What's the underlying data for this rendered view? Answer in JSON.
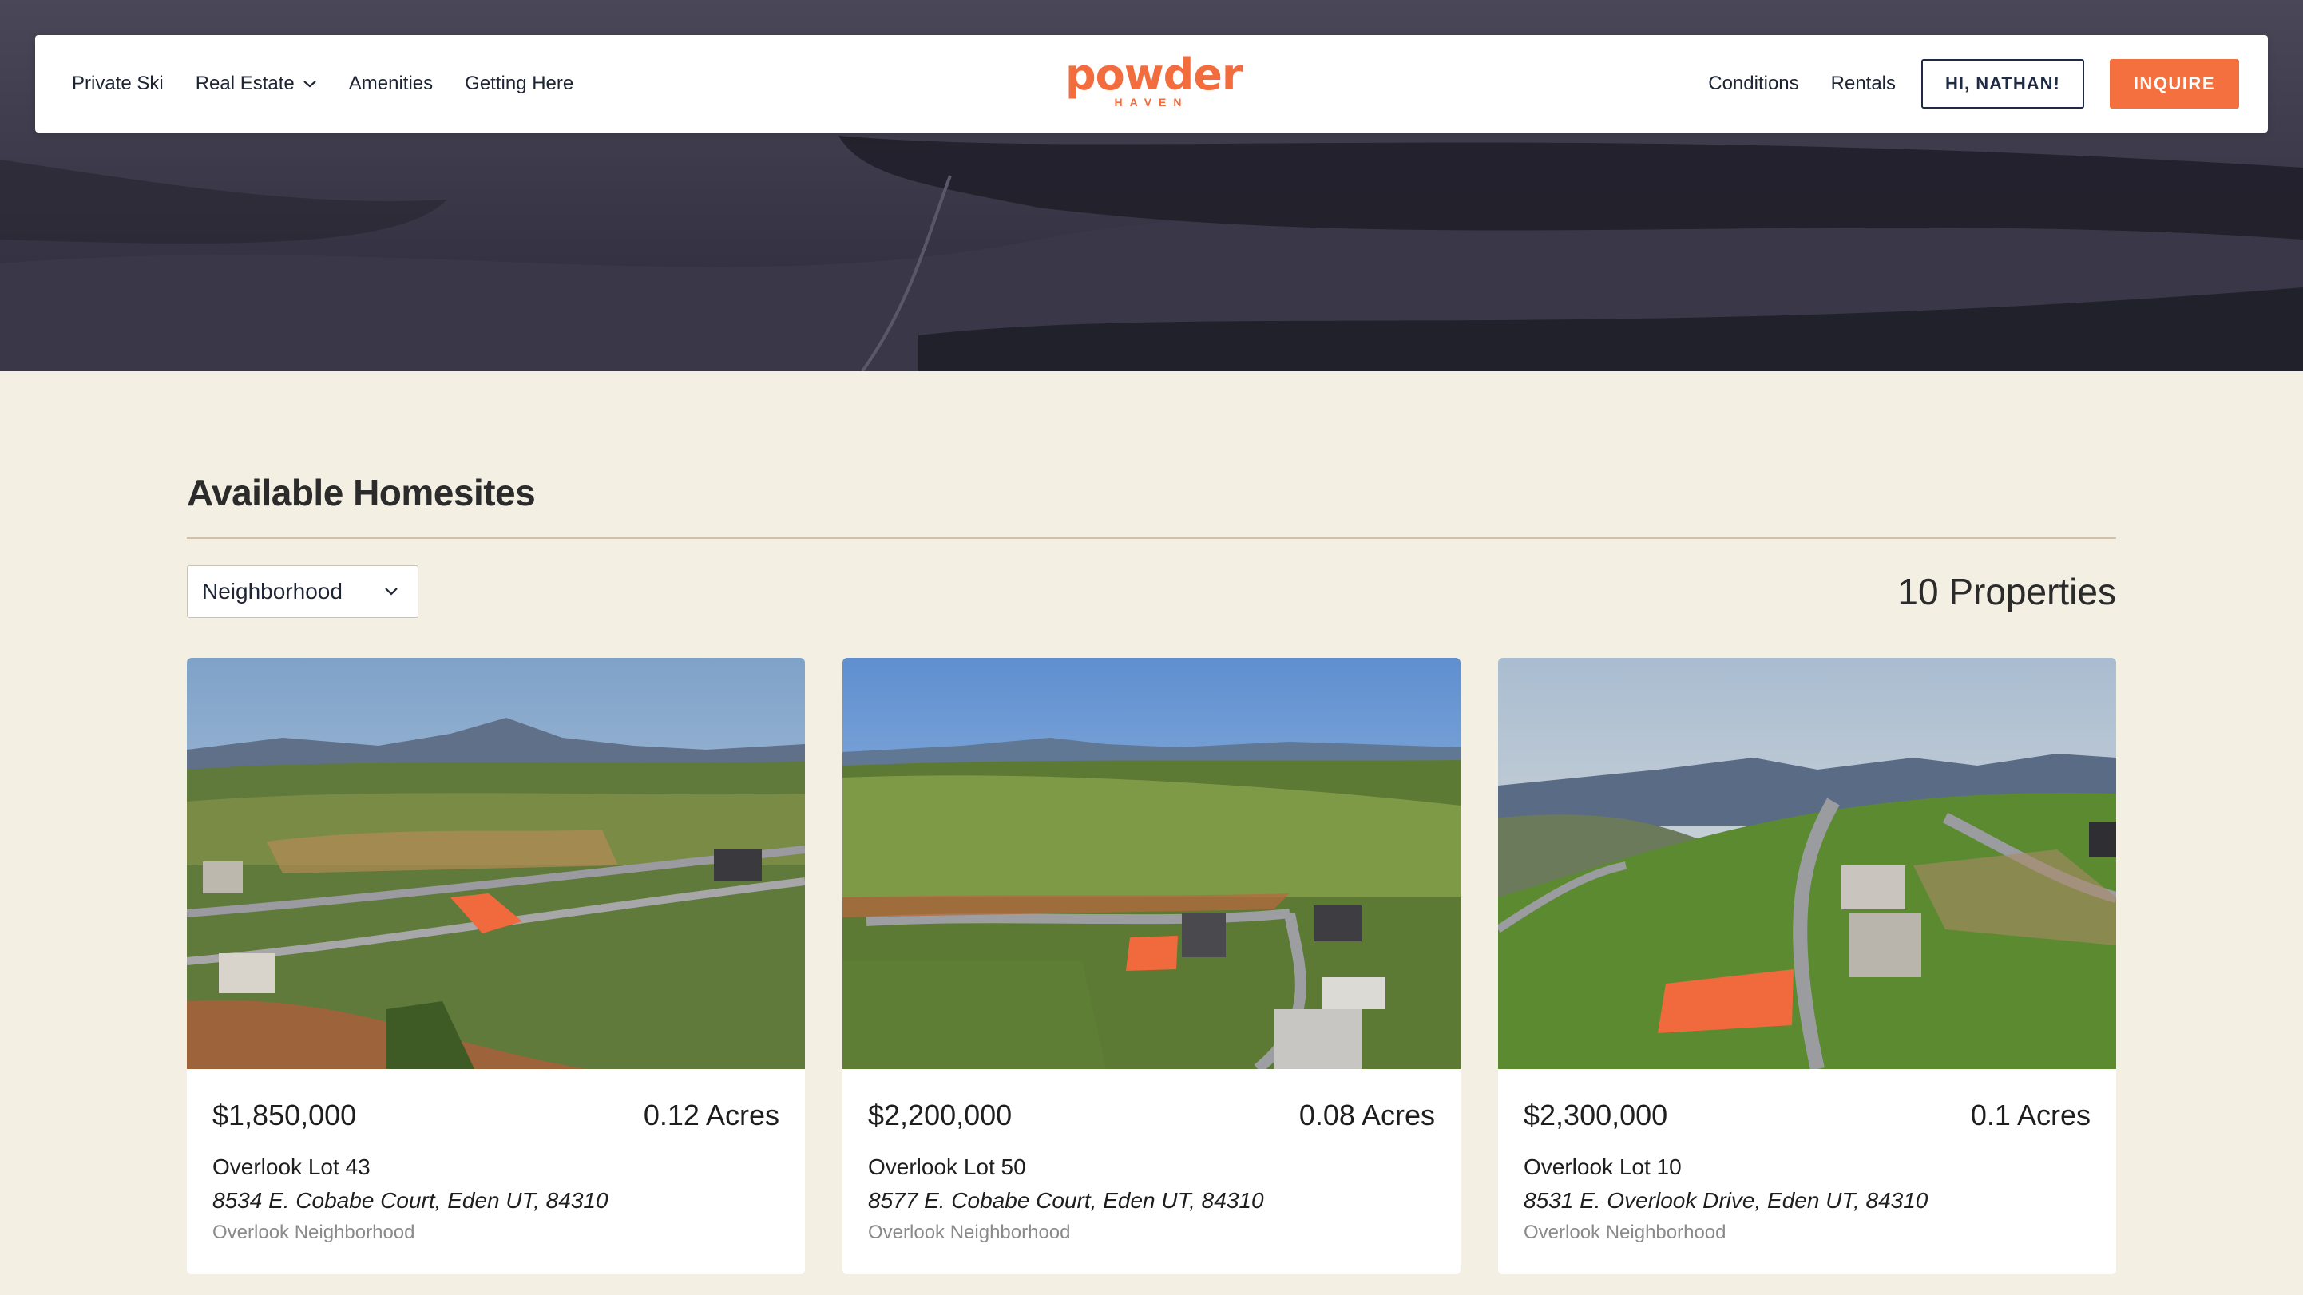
{
  "nav": {
    "left_items": [
      "Private Ski",
      "Real Estate",
      "Amenities",
      "Getting Here"
    ],
    "right_items": [
      "Conditions",
      "Rentals"
    ],
    "user_button": "HI, NATHAN!",
    "inquire_button": "INQUIRE"
  },
  "logo": {
    "main": "powder",
    "sub": "HAVEN"
  },
  "section": {
    "title": "Available Homesites",
    "filter_label": "Neighborhood",
    "count": "10 Properties"
  },
  "cards": [
    {
      "price": "$1,850,000",
      "acres": "0.12 Acres",
      "lot": "Overlook Lot 43",
      "address": "8534 E. Cobabe Court, Eden UT, 84310",
      "neighborhood": "Overlook Neighborhood"
    },
    {
      "price": "$2,200,000",
      "acres": "0.08 Acres",
      "lot": "Overlook Lot 50",
      "address": "8577 E. Cobabe Court, Eden UT, 84310",
      "neighborhood": "Overlook Neighborhood"
    },
    {
      "price": "$2,300,000",
      "acres": "0.1 Acres",
      "lot": "Overlook Lot 10",
      "address": "8531 E. Overlook Drive, Eden UT, 84310",
      "neighborhood": "Overlook Neighborhood"
    }
  ],
  "colors": {
    "accent": "#f4703f",
    "background": "#f3efe3",
    "navy": "#1f2a44"
  }
}
